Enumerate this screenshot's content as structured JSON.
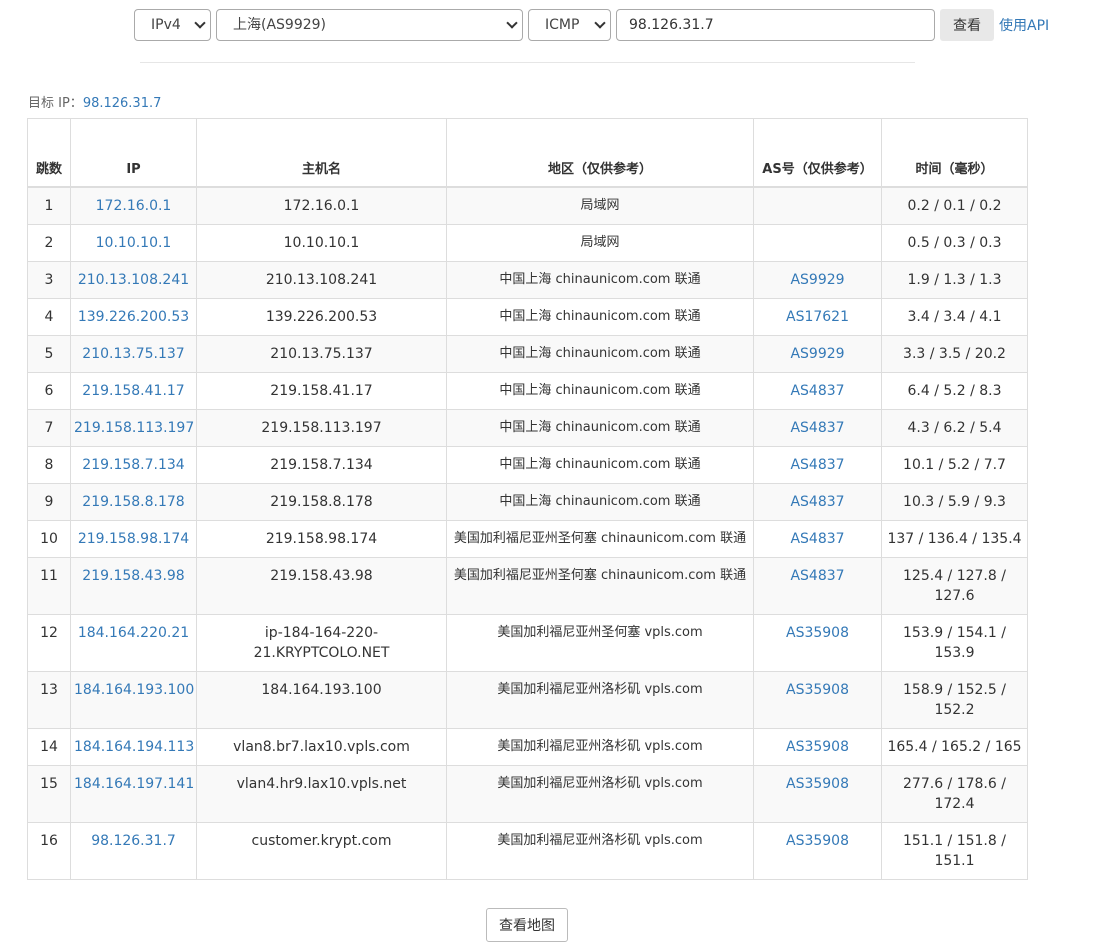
{
  "form": {
    "ip_version": "IPv4",
    "node": "上海(AS9929)",
    "protocol": "ICMP",
    "target_ip": "98.126.31.7",
    "query_label": "查看",
    "api_label": "使用API"
  },
  "target": {
    "label": "目标 IP：",
    "value": "98.126.31.7"
  },
  "table": {
    "headers": [
      "跳数",
      "IP",
      "主机名",
      "地区（仅供参考）",
      "AS号（仅供参考）",
      "时间（毫秒）"
    ],
    "rows": [
      [
        "1",
        "172.16.0.1",
        "172.16.0.1",
        "局域网",
        "",
        "0.2 / 0.1 / 0.2"
      ],
      [
        "2",
        "10.10.10.1",
        "10.10.10.1",
        "局域网",
        "",
        "0.5 / 0.3 / 0.3"
      ],
      [
        "3",
        "210.13.108.241",
        "210.13.108.241",
        "中国上海 chinaunicom.com 联通",
        "AS9929",
        "1.9 / 1.3 / 1.3"
      ],
      [
        "4",
        "139.226.200.53",
        "139.226.200.53",
        "中国上海 chinaunicom.com 联通",
        "AS17621",
        "3.4 / 3.4 / 4.1"
      ],
      [
        "5",
        "210.13.75.137",
        "210.13.75.137",
        "中国上海 chinaunicom.com 联通",
        "AS9929",
        "3.3 / 3.5 / 20.2"
      ],
      [
        "6",
        "219.158.41.17",
        "219.158.41.17",
        "中国上海 chinaunicom.com 联通",
        "AS4837",
        "6.4 / 5.2 / 8.3"
      ],
      [
        "7",
        "219.158.113.197",
        "219.158.113.197",
        "中国上海 chinaunicom.com 联通",
        "AS4837",
        "4.3 / 6.2 / 5.4"
      ],
      [
        "8",
        "219.158.7.134",
        "219.158.7.134",
        "中国上海 chinaunicom.com 联通",
        "AS4837",
        "10.1 / 5.2 / 7.7"
      ],
      [
        "9",
        "219.158.8.178",
        "219.158.8.178",
        "中国上海 chinaunicom.com 联通",
        "AS4837",
        "10.3 / 5.9 / 9.3"
      ],
      [
        "10",
        "219.158.98.174",
        "219.158.98.174",
        "美国加利福尼亚州圣何塞 chinaunicom.com 联通",
        "AS4837",
        "137 / 136.4 / 135.4"
      ],
      [
        "11",
        "219.158.43.98",
        "219.158.43.98",
        "美国加利福尼亚州圣何塞 chinaunicom.com 联通",
        "AS4837",
        "125.4 / 127.8 / 127.6"
      ],
      [
        "12",
        "184.164.220.21",
        "ip-184-164-220-21.KRYPTCOLO.NET",
        "美国加利福尼亚州圣何塞 vpls.com",
        "AS35908",
        "153.9 / 154.1 / 153.9"
      ],
      [
        "13",
        "184.164.193.100",
        "184.164.193.100",
        "美国加利福尼亚州洛杉矶 vpls.com",
        "AS35908",
        "158.9 / 152.5 / 152.2"
      ],
      [
        "14",
        "184.164.194.113",
        "vlan8.br7.lax10.vpls.com",
        "美国加利福尼亚州洛杉矶 vpls.com",
        "AS35908",
        "165.4 / 165.2 / 165"
      ],
      [
        "15",
        "184.164.197.141",
        "vlan4.hr9.lax10.vpls.net",
        "美国加利福尼亚州洛杉矶 vpls.com",
        "AS35908",
        "277.6 / 178.6 / 172.4"
      ],
      [
        "16",
        "98.126.31.7",
        "customer.krypt.com",
        "美国加利福尼亚州洛杉矶 vpls.com",
        "AS35908",
        "151.1 / 151.8 / 151.1"
      ]
    ]
  },
  "map_button": "查看地图"
}
